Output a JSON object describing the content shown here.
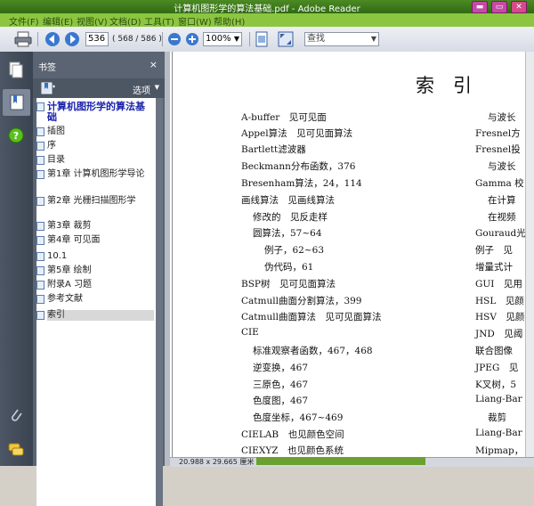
{
  "window": {
    "title": "计算机图形学的算法基础.pdf - Adobe Reader"
  },
  "menu": [
    "文件(F)",
    "编辑(E)",
    "视图(V)",
    "文档(D)",
    "工具(T)",
    "窗口(W)",
    "帮助(H)"
  ],
  "toolbar": {
    "page_value": "536",
    "page_count": "( 568 / 586 )",
    "zoom_value": "100%",
    "search_placeholder": "查找"
  },
  "panel": {
    "title": "书签",
    "close": "×",
    "options": "选项"
  },
  "bookmarks": [
    "计算机图形学的算法基础",
    "插图",
    "序",
    "目录",
    "第1章 计算机图形学导论",
    "第2章 光栅扫描图形学",
    "第3章 裁剪",
    "第4章 可见面",
    "10.1",
    "第5章 绘制",
    "附录A 习题",
    "参考文献",
    "索引"
  ],
  "document": {
    "heading": "索　引",
    "left_entries": [
      "A-buffer　见可见面",
      "Appel算法　见可见面算法",
      "Bartlett滤波器",
      "Beckmann分布函数，376",
      "Bresenham算法，24，114",
      "画线算法　见画线算法",
      "修改的　见反走样",
      "圆算法，57~64",
      "例子，62~63",
      "伪代码，61",
      "BSP树　见可见面算法",
      "Catmull曲面分割算法，399",
      "Catmull曲面算法　见可见面算法",
      "CIE",
      "标准观察者函数，467，468",
      "逆变换，467",
      "三原色，467",
      "色度图，467",
      "色度坐标，467~469",
      "CIELAB　也见颜色空间",
      "CIEXYZ　也见颜色系统"
    ],
    "right_entries": [
      "与波长",
      "Fresnel方",
      "Fresnel投",
      "与波长",
      "Gamma 校",
      "在计算",
      "在视频",
      "Gouraud光",
      "例子　见",
      "增量式计",
      "GUI　见用",
      "HSL　见颜",
      "HSV　见颜",
      "JND　见阈",
      "联合图像",
      "JPEG　见",
      "K叉树，5",
      "Liang-Bar",
      "裁剪",
      "Liang-Bar",
      "Mipmap，"
    ]
  },
  "status": {
    "page_size": "20.988 x 29.665 厘米"
  }
}
